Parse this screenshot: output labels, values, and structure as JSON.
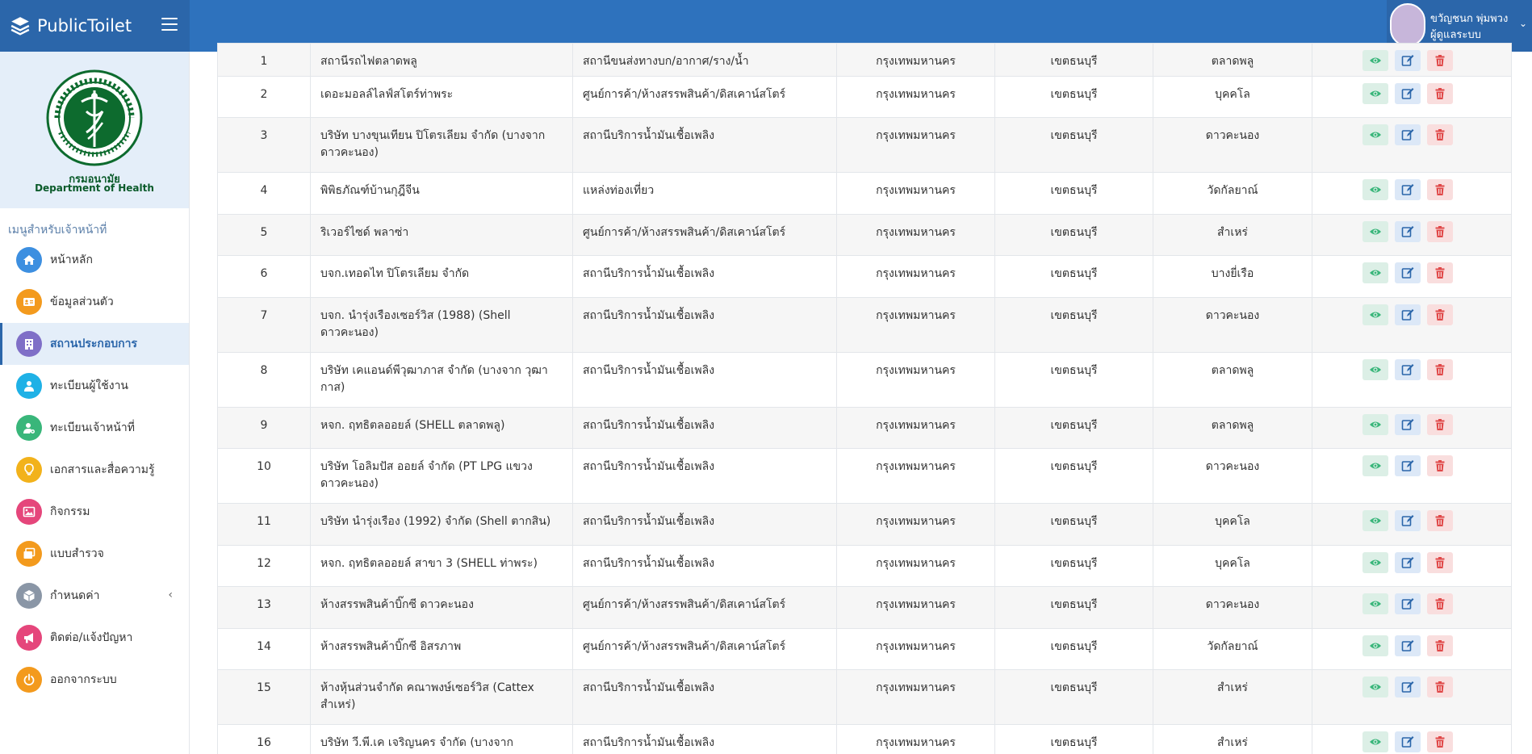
{
  "app": {
    "brand": "PublicToilet"
  },
  "user": {
    "name": "ขวัญชนก พุ่มพวง",
    "role": "ผู้ดูแลระบบ"
  },
  "sidebar": {
    "department_th": "กรมอนามัย",
    "department_en": "Department of Health",
    "seal_text": "กระทรวงสาธารณสุข MINISTRY OF PUBLIC HEALTH",
    "menu_header": "เมนูสำหรับเจ้าหน้าที่",
    "items": [
      {
        "label": "หน้าหลัก",
        "icon": "home-icon",
        "color": "#3d8fe0"
      },
      {
        "label": "ข้อมูลส่วนตัว",
        "icon": "id-card-icon",
        "color": "#f39a1d"
      },
      {
        "label": "สถานประกอบการ",
        "icon": "building-icon",
        "color": "#7f6fc7"
      },
      {
        "label": "ทะเบียนผู้ใช้งาน",
        "icon": "user-icon",
        "color": "#1fb1e6"
      },
      {
        "label": "ทะเบียนเจ้าหน้าที่",
        "icon": "user-gear-icon",
        "color": "#39b67a"
      },
      {
        "label": "เอกสารและสื่อความรู้",
        "icon": "lightbulb-icon",
        "color": "#f2b21b"
      },
      {
        "label": "กิจกรรม",
        "icon": "image-icon",
        "color": "#e5467b"
      },
      {
        "label": "แบบสำรวจ",
        "icon": "window-icon",
        "color": "#f39a1d"
      },
      {
        "label": "กำหนดค่า",
        "icon": "cube-icon",
        "color": "#8a96a6"
      },
      {
        "label": "ติดต่อ/แจ้งปัญหา",
        "icon": "megaphone-icon",
        "color": "#e5467b"
      },
      {
        "label": "ออกจากระบบ",
        "icon": "power-icon",
        "color": "#f39a1d"
      }
    ]
  },
  "table": {
    "rows": [
      {
        "no": "1",
        "name": "สถานีรถไฟตลาดพลู",
        "type": "สถานีขนส่งทางบก/อากาศ/ราง/น้ำ",
        "province": "กรุงเทพมหานคร",
        "district": "เขตธนบุรี",
        "subdistrict": "ตลาดพลู"
      },
      {
        "no": "2",
        "name": "เดอะมอลล์ไลฟ์สโตร์ท่าพระ",
        "type": "ศูนย์การค้า/ห้างสรรพสินค้า/ดิสเคาน์สโตร์",
        "province": "กรุงเทพมหานคร",
        "district": "เขตธนบุรี",
        "subdistrict": "บุคคโล"
      },
      {
        "no": "3",
        "name": "บริษัท บางขุนเทียน ปิโตรเลียม จำกัด (บางจาก ดาวคะนอง)",
        "type": "สถานีบริการน้ำมันเชื้อเพลิง",
        "province": "กรุงเทพมหานคร",
        "district": "เขตธนบุรี",
        "subdistrict": "ดาวคะนอง"
      },
      {
        "no": "4",
        "name": "พิพิธภัณฑ์บ้านกุฎีจีน",
        "type": "แหล่งท่องเที่ยว",
        "province": "กรุงเทพมหานคร",
        "district": "เขตธนบุรี",
        "subdistrict": "วัดกัลยาณ์"
      },
      {
        "no": "5",
        "name": "ริเวอร์ไซด์ พลาซ่า",
        "type": "ศูนย์การค้า/ห้างสรรพสินค้า/ดิสเคาน์สโตร์",
        "province": "กรุงเทพมหานคร",
        "district": "เขตธนบุรี",
        "subdistrict": "สำเหร่"
      },
      {
        "no": "6",
        "name": "บจก.เทอดไท ปิโตรเลียม จำกัด",
        "type": "สถานีบริการน้ำมันเชื้อเพลิง",
        "province": "กรุงเทพมหานคร",
        "district": "เขตธนบุรี",
        "subdistrict": "บางยี่เรือ"
      },
      {
        "no": "7",
        "name": "บจก. นำรุ่งเรืองเซอร์วิส (1988) (Shell ดาวคะนอง)",
        "type": "สถานีบริการน้ำมันเชื้อเพลิง",
        "province": "กรุงเทพมหานคร",
        "district": "เขตธนบุรี",
        "subdistrict": "ดาวคะนอง"
      },
      {
        "no": "8",
        "name": "บริษัท เคแอนด์พีวุฒาภาส จำกัด (บางจาก วุฒากาส)",
        "type": "สถานีบริการน้ำมันเชื้อเพลิง",
        "province": "กรุงเทพมหานคร",
        "district": "เขตธนบุรี",
        "subdistrict": "ตลาดพลู"
      },
      {
        "no": "9",
        "name": "หจก. ฤทธิตลออยล์ (SHELL ตลาดพลู)",
        "type": "สถานีบริการน้ำมันเชื้อเพลิง",
        "province": "กรุงเทพมหานคร",
        "district": "เขตธนบุรี",
        "subdistrict": "ตลาดพลู"
      },
      {
        "no": "10",
        "name": "บริษัท โอลิมปัส ออยล์ จำกัด (PT LPG แขวง ดาวคะนอง)",
        "type": "สถานีบริการน้ำมันเชื้อเพลิง",
        "province": "กรุงเทพมหานคร",
        "district": "เขตธนบุรี",
        "subdistrict": "ดาวคะนอง"
      },
      {
        "no": "11",
        "name": "บริษัท นำรุ่งเรือง (1992) จำกัด (Shell ตากสิน)",
        "type": "สถานีบริการน้ำมันเชื้อเพลิง",
        "province": "กรุงเทพมหานคร",
        "district": "เขตธนบุรี",
        "subdistrict": "บุคคโล"
      },
      {
        "no": "12",
        "name": "หจก. ฤทธิตลออยล์ สาขา 3 (SHELL ท่าพระ)",
        "type": "สถานีบริการน้ำมันเชื้อเพลิง",
        "province": "กรุงเทพมหานคร",
        "district": "เขตธนบุรี",
        "subdistrict": "บุคคโล"
      },
      {
        "no": "13",
        "name": "ห้างสรรพสินค้าบิ๊กซี ดาวคะนอง",
        "type": "ศูนย์การค้า/ห้างสรรพสินค้า/ดิสเคาน์สโตร์",
        "province": "กรุงเทพมหานคร",
        "district": "เขตธนบุรี",
        "subdistrict": "ดาวคะนอง"
      },
      {
        "no": "14",
        "name": "ห้างสรรพสินค้าบิ๊กซี อิสรภาพ",
        "type": "ศูนย์การค้า/ห้างสรรพสินค้า/ดิสเคาน์สโตร์",
        "province": "กรุงเทพมหานคร",
        "district": "เขตธนบุรี",
        "subdistrict": "วัดกัลยาณ์"
      },
      {
        "no": "15",
        "name": "ห้างหุ้นส่วนจำกัด คณาพงษ์เซอร์วิส (Cattex สำเหร่)",
        "type": "สถานีบริการน้ำมันเชื้อเพลิง",
        "province": "กรุงเทพมหานคร",
        "district": "เขตธนบุรี",
        "subdistrict": "สำเหร่"
      },
      {
        "no": "16",
        "name": "บริษัท วี.พี.เค เจริญนคร จำกัด (บางจาก",
        "type": "สถานีบริการน้ำมันเชื้อเพลิง",
        "province": "กรุงเทพมหานคร",
        "district": "เขตธนบุรี",
        "subdistrict": "สำเหร่"
      }
    ]
  },
  "colors": {
    "topbar": "#2e72bd",
    "brand_bg": "#2b66aa",
    "view": "#39b67a",
    "edit": "#2b66aa",
    "delete": "#e04848"
  }
}
